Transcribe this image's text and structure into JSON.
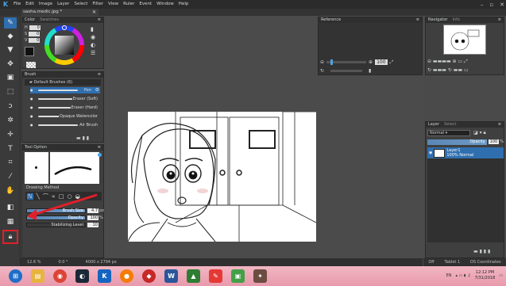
{
  "menubar": {
    "items": [
      "File",
      "Edit",
      "Image",
      "Layer",
      "Select",
      "Filter",
      "View",
      "Ruler",
      "Event",
      "Window",
      "Help"
    ]
  },
  "document": {
    "tab_title": "sasha.medic.jpg *"
  },
  "color_panel": {
    "tab_color": "Color",
    "tab_swatches": "Swatches",
    "hsv": [
      {
        "label": "H",
        "value": "0"
      },
      {
        "label": "S",
        "value": "0"
      },
      {
        "label": "V",
        "value": "0"
      }
    ],
    "primary": "#111111",
    "secondary": "#ffffff"
  },
  "brush_panel": {
    "title": "Brush",
    "group": "Default Brushes (6)",
    "brushes": [
      {
        "name": "Pen",
        "selected": true
      },
      {
        "name": "Eraser (Soft)"
      },
      {
        "name": "Eraser (Hard)"
      },
      {
        "name": "Opaque Watercolor"
      },
      {
        "name": "Air Brush"
      }
    ]
  },
  "tool_option": {
    "title": "Tool Option",
    "drawing_method": "Drawing Method",
    "brush_size_label": "Brush Size",
    "brush_size": "4.7",
    "brush_size_unit": "px",
    "opacity_label": "Opacity",
    "opacity": "100",
    "opacity_unit": "%",
    "stabilizing_label": "Stabilizing Level",
    "stabilizing": "10"
  },
  "reference": {
    "title": "Reference",
    "zoom": "100"
  },
  "navigator": {
    "tab_navigator": "Navigator",
    "tab_info": "Info"
  },
  "layer_panel": {
    "tab_layer": "Layer",
    "tab_select": "Select",
    "blend_mode": "Normal",
    "opacity_label": "Opacity",
    "opacity_value": "100",
    "opacity_unit": "%",
    "layers": [
      {
        "name": "Layer1",
        "detail": "100% Normal"
      }
    ]
  },
  "status": {
    "zoom": "12.6 %",
    "angle": "0.0 °",
    "size": "4000 x 2794 px"
  },
  "right_status": {
    "off": "Off",
    "tablet": "Tablet 1",
    "os": "OS Coordinates"
  },
  "taskbar": {
    "time": "12:12 PM",
    "date": "7/31/2018",
    "lang": "EN"
  },
  "colors": {
    "accent": "#2f6fb0",
    "highlight_red": "#e0202a",
    "slider_blue": "#5a87b4"
  }
}
